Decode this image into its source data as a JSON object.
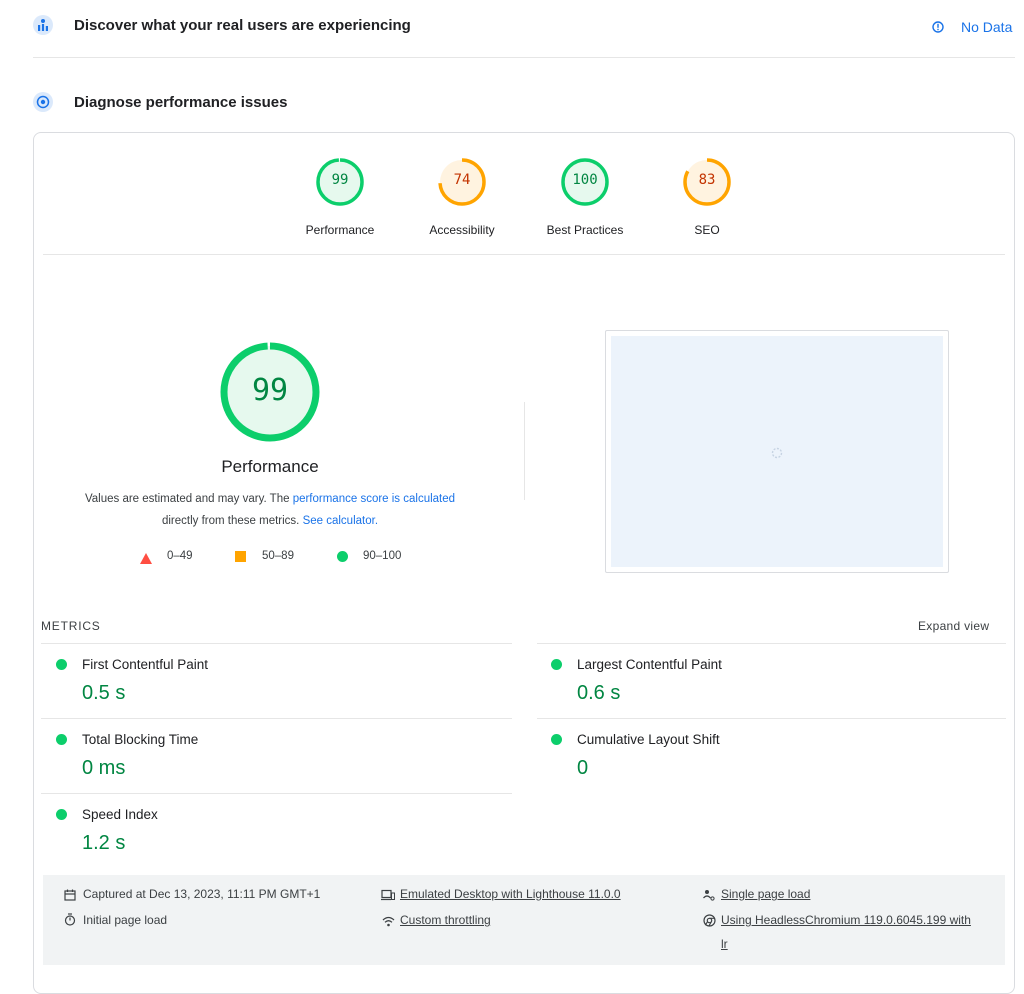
{
  "crux": {
    "title": "Discover what your real users are experiencing",
    "status": "No Data"
  },
  "diagnose": {
    "title": "Diagnose performance issues"
  },
  "categories": [
    {
      "label": "Performance",
      "score": "99",
      "value": 99,
      "color": "#0cce6b",
      "text_color": "#018642",
      "bg": "#e6f9ee"
    },
    {
      "label": "Accessibility",
      "score": "74",
      "value": 74,
      "color": "#ffa400",
      "text_color": "#c33300",
      "bg": "#fff3e0"
    },
    {
      "label": "Best Practices",
      "score": "100",
      "value": 100,
      "color": "#0cce6b",
      "text_color": "#018642",
      "bg": "#e6f9ee"
    },
    {
      "label": "SEO",
      "score": "83",
      "value": 83,
      "color": "#ffa400",
      "text_color": "#c33300",
      "bg": "#fff3e0"
    }
  ],
  "performance": {
    "score": "99",
    "value": 99,
    "label": "Performance",
    "note_prefix": "Values are estimated and may vary. The ",
    "note_link1": "performance score is calculated",
    "note_mid": "directly from these metrics. ",
    "note_link2": "See calculator."
  },
  "legend": [
    {
      "shape": "triangle",
      "color": "#ff4e42",
      "range": "0–49"
    },
    {
      "shape": "square",
      "color": "#ffa400",
      "range": "50–89"
    },
    {
      "shape": "circle",
      "color": "#0cce6b",
      "range": "90–100"
    }
  ],
  "metrics": {
    "header": "METRICS",
    "expand": "Expand view",
    "items": [
      {
        "name": "First Contentful Paint",
        "value": "0.5 s"
      },
      {
        "name": "Largest Contentful Paint",
        "value": "0.6 s"
      },
      {
        "name": "Total Blocking Time",
        "value": "0 ms"
      },
      {
        "name": "Cumulative Layout Shift",
        "value": "0"
      },
      {
        "name": "Speed Index",
        "value": "1.2 s"
      }
    ]
  },
  "footer": {
    "captured": "Captured at Dec 13, 2023, 11:11 PM GMT+1",
    "initial": "Initial page load",
    "emulated": "Emulated Desktop with Lighthouse 11.0.0",
    "throttling": "Custom throttling",
    "single": "Single page load",
    "using_line1": "Using HeadlessChromium 119.0.6045.199 with",
    "using_line2": "lr"
  },
  "icons": {
    "crux": "people-chart-icon",
    "diagnose": "target-icon",
    "info": "info-icon"
  }
}
